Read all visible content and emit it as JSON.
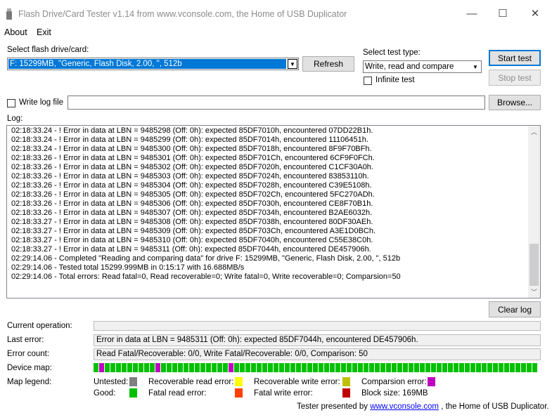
{
  "window": {
    "title": "Flash Drive/Card Tester v1.14 from www.vconsole.com, the Home of USB Duplicator",
    "minimize": "—",
    "maximize": "☐",
    "close": "✕"
  },
  "menu": [
    "About",
    "Exit"
  ],
  "drive": {
    "label": "Select flash drive/card:",
    "value": "F: 15299MB, \"Generic, Flash Disk, 2.00, \", 512b",
    "refresh": "Refresh"
  },
  "test_type": {
    "label": "Select test type:",
    "value": "Write, read and compare",
    "infinite_label": "Infinite test",
    "infinite_checked": false
  },
  "buttons": {
    "start": "Start test",
    "stop": "Stop test",
    "browse": "Browse...",
    "clear": "Clear log"
  },
  "log_file": {
    "label": "Write log file",
    "checked": false,
    "path": ""
  },
  "log": {
    "title": "Log:",
    "lines": [
      "02:18:33.24 - ! Error in data at LBN = 9485298 (Off: 0h): expected 85DF7010h, encountered 07DD22B1h.",
      "02:18:33.24 - ! Error in data at LBN = 9485299 (Off: 0h): expected 85DF7014h, encountered 11106451h.",
      "02:18:33.24 - ! Error in data at LBN = 9485300 (Off: 0h): expected 85DF7018h, encountered 8F9F70BFh.",
      "02:18:33.26 - ! Error in data at LBN = 9485301 (Off: 0h): expected 85DF701Ch, encountered 6CF9F0FCh.",
      "02:18:33.26 - ! Error in data at LBN = 9485302 (Off: 0h): expected 85DF7020h, encountered C1CF30A0h.",
      "02:18:33.26 - ! Error in data at LBN = 9485303 (Off: 0h): expected 85DF7024h, encountered 83853110h.",
      "02:18:33.26 - ! Error in data at LBN = 9485304 (Off: 0h): expected 85DF7028h, encountered C39E5108h.",
      "02:18:33.26 - ! Error in data at LBN = 9485305 (Off: 0h): expected 85DF702Ch, encountered 5FC270ADh.",
      "02:18:33.26 - ! Error in data at LBN = 9485306 (Off: 0h): expected 85DF7030h, encountered CE8F70B1h.",
      "02:18:33.26 - ! Error in data at LBN = 9485307 (Off: 0h): expected 85DF7034h, encountered B2AE6032h.",
      "02:18:33.27 - ! Error in data at LBN = 9485308 (Off: 0h): expected 85DF7038h, encountered 80DF30AEh.",
      "02:18:33.27 - ! Error in data at LBN = 9485309 (Off: 0h): expected 85DF703Ch, encountered A3E1D0BCh.",
      "02:18:33.27 - ! Error in data at LBN = 9485310 (Off: 0h): expected 85DF7040h, encountered C55E38C0h.",
      "02:18:33.27 - ! Error in data at LBN = 9485311 (Off: 0h): expected 85DF7044h, encountered DE457906h.",
      "02:29:14.06 - Completed \"Reading and comparing data\" for drive F: 15299MB, \"Generic, Flash Disk, 2.00, \", 512b",
      "02:29:14.06 - Tested total 15299.999MB in 0:15:17 with 16.688MB/s",
      "02:29:14.06 - Total errors: Read fatal=0, Read recoverable=0; Write fatal=0, Write recoverable=0; Comparsion=50"
    ]
  },
  "status": {
    "current_operation_label": "Current operation:",
    "current_operation": "",
    "last_error_label": "Last error:",
    "last_error": "Error in data at LBN = 9485311 (Off: 0h): expected 85DF7044h, encountered DE457906h.",
    "error_count_label": "Error count:",
    "error_count": "Read Fatal/Recoverable: 0/0, Write Fatal/Recoverable: 0/0, Comparison: 50",
    "device_map_label": "Device map:",
    "device_map_cells": 79,
    "device_map_bad_cells": [
      1,
      11,
      24
    ]
  },
  "legend": {
    "label": "Map legend:",
    "untested": "Untested:",
    "good": "Good:",
    "recoverable_read": "Recoverable read error:",
    "fatal_read": "Fatal read error:",
    "recoverable_write": "Recoverable write error:",
    "fatal_write": "Fatal write error:",
    "comparsion": "Comparsion error:",
    "block_size": "Block size: 169MB",
    "colors": {
      "untested": "#808080",
      "good": "#00c000",
      "recoverable_read": "#ffff00",
      "fatal_read": "#ff4000",
      "recoverable_write": "#c0c000",
      "fatal_write": "#c00000",
      "comparsion": "#c000c0"
    }
  },
  "footer": {
    "prefix": "Tester presented by ",
    "link": "www.vconsole.com",
    "suffix": " , the Home of USB Duplicator."
  }
}
